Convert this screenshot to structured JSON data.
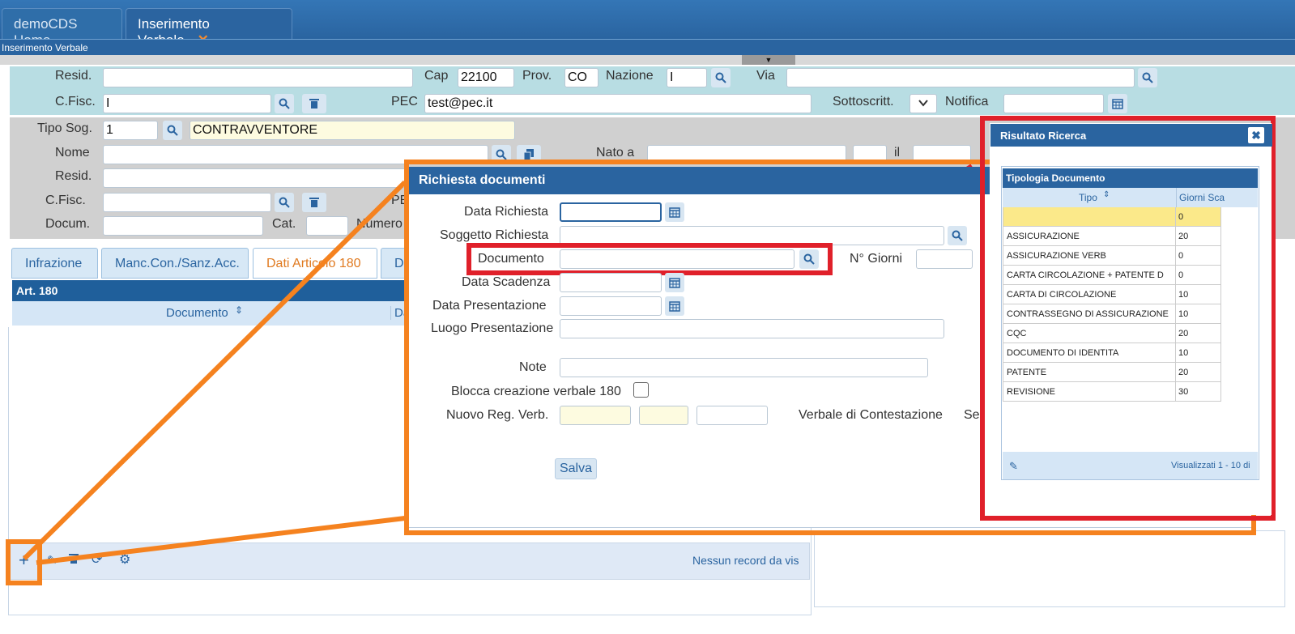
{
  "tabs": {
    "home": "demoCDS Home",
    "active": "Inserimento Verbale",
    "close": "✕"
  },
  "breadcrumb": "Inserimento Verbale",
  "collapse_glyph": "▼",
  "residenza": {
    "resid_label": "Resid.",
    "resid_value": "",
    "cap_label": "Cap",
    "cap_value": "22100",
    "prov_label": "Prov.",
    "prov_value": "CO",
    "nazione_label": "Nazione",
    "nazione_value": "I",
    "via_label": "Via",
    "via_value": "",
    "cfisc_label": "C.Fisc.",
    "cfisc_value": "I",
    "pec_label": "PEC",
    "pec_value": "test@pec.it",
    "sottoscritt_label": "Sottoscritt.",
    "notifica_label": "Notifica",
    "notifica_value": ""
  },
  "soggetto": {
    "tipo_label": "Tipo Sog.",
    "tipo_value": "1",
    "tipo_desc": "CONTRAVVENTORE",
    "nome_label": "Nome",
    "nato_label": "Nato a",
    "il_label": "il",
    "resid_label": "Resid.",
    "cfisc_label": "C.Fisc.",
    "pe_label": "PE",
    "docum_label": "Docum.",
    "cat_label": "Cat.",
    "numero_label": "Numero"
  },
  "section_tabs": [
    "Infrazione",
    "Manc.Con./Sanz.Acc.",
    "Dati Articolo 180",
    "Da"
  ],
  "art180": {
    "title": "Art. 180",
    "col_documento": "Documento",
    "col_da": "Da",
    "status": "Nessun record da vis"
  },
  "dialog": {
    "title": "Richiesta documenti",
    "data_richiesta": "Data Richiesta",
    "soggetto_richiesta": "Soggetto Richiesta",
    "documento": "Documento",
    "n_giorni": "N° Giorni",
    "data_scadenza": "Data Scadenza",
    "data_presentazione": "Data Presentazione",
    "luogo_presentazione": "Luogo Presentazione",
    "note": "Note",
    "blocca": "Blocca creazione verbale 180",
    "nuovo_reg": "Nuovo Reg. Verb.",
    "verbale_contestazione": "Verbale di Contestazione",
    "se": "Se",
    "salva": "Salva"
  },
  "search_result": {
    "title": "Risultato Ricerca",
    "close": "✖",
    "panel_title": "Tipologia Documento",
    "col_tipo": "Tipo",
    "col_giorni": "Giorni Sca",
    "rows": [
      {
        "tipo": "",
        "giorni": "0"
      },
      {
        "tipo": "ASSICURAZIONE",
        "giorni": "20"
      },
      {
        "tipo": "ASSICURAZIONE VERB",
        "giorni": "0"
      },
      {
        "tipo": "CARTA CIRCOLAZIONE + PATENTE D",
        "giorni": "0"
      },
      {
        "tipo": "CARTA DI CIRCOLAZIONE",
        "giorni": "10"
      },
      {
        "tipo": "CONTRASSEGNO DI ASSICURAZIONE",
        "giorni": "10"
      },
      {
        "tipo": "CQC",
        "giorni": "20"
      },
      {
        "tipo": "DOCUMENTO DI IDENTITA",
        "giorni": "10"
      },
      {
        "tipo": "PATENTE",
        "giorni": "20"
      },
      {
        "tipo": "REVISIONE",
        "giorni": "30"
      }
    ],
    "footer": "Visualizzati 1 - 10 di"
  },
  "colors": {
    "header": "#2a64a0",
    "highlight_orange": "#f5821f",
    "highlight_red": "#e0202a"
  }
}
